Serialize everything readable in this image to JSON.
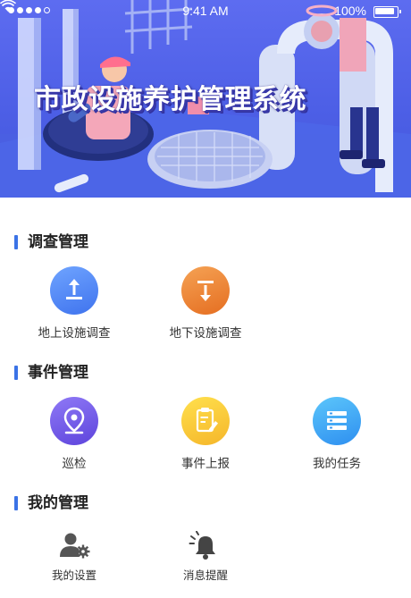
{
  "status_bar": {
    "time": "9:41 AM",
    "battery": "100%"
  },
  "banner": {
    "title": "市政设施养护管理系统"
  },
  "sections": [
    {
      "title": "调查管理",
      "items": [
        {
          "label": "地上设施调查",
          "icon": "upload-icon"
        },
        {
          "label": "地下设施调查",
          "icon": "download-icon"
        }
      ]
    },
    {
      "title": "事件管理",
      "items": [
        {
          "label": "巡检",
          "icon": "location-pin-icon"
        },
        {
          "label": "事件上报",
          "icon": "report-edit-icon"
        },
        {
          "label": "我的任务",
          "icon": "task-list-icon"
        }
      ]
    },
    {
      "title": "我的管理",
      "items": [
        {
          "label": "我的设置",
          "icon": "user-settings-icon"
        },
        {
          "label": "消息提醒",
          "icon": "bell-icon"
        }
      ]
    }
  ],
  "colors": {
    "accent": "#3b73e6",
    "banner": "#4d5fe6"
  }
}
